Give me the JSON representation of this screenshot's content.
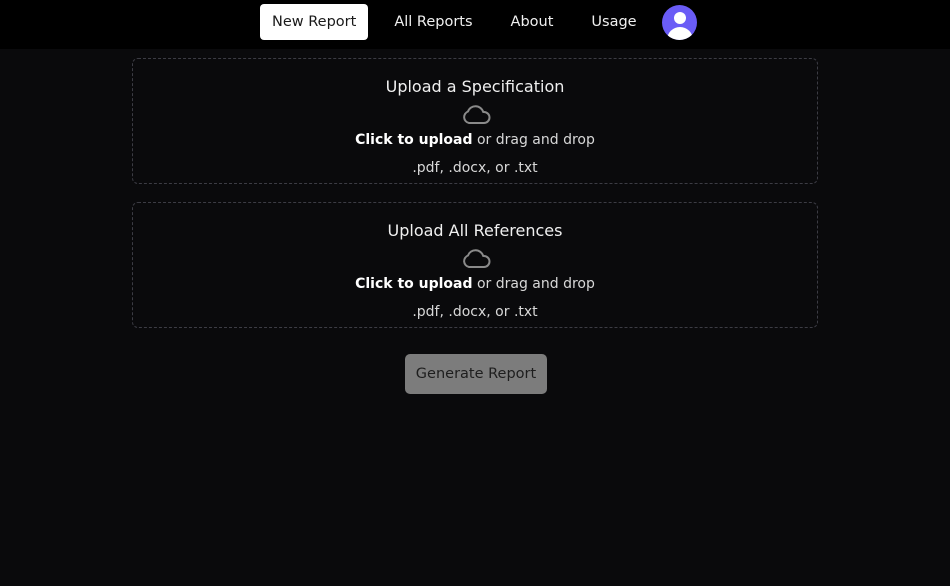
{
  "nav": {
    "items": [
      {
        "label": "New Report",
        "active": true
      },
      {
        "label": "All Reports",
        "active": false
      },
      {
        "label": "About",
        "active": false
      },
      {
        "label": "Usage",
        "active": false
      }
    ],
    "avatar_icon": "user-avatar-icon",
    "avatar_color": "#6a5cf6"
  },
  "uploads": [
    {
      "title": "Upload a Specification",
      "icon": "cloud-icon",
      "action_strong": "Click to upload",
      "action_rest": " or drag and drop",
      "types": ".pdf, .docx, or .txt"
    },
    {
      "title": "Upload All References",
      "icon": "cloud-icon",
      "action_strong": "Click to upload",
      "action_rest": " or drag and drop",
      "types": ".pdf, .docx, or .txt"
    }
  ],
  "generate_button": {
    "label": "Generate Report"
  }
}
